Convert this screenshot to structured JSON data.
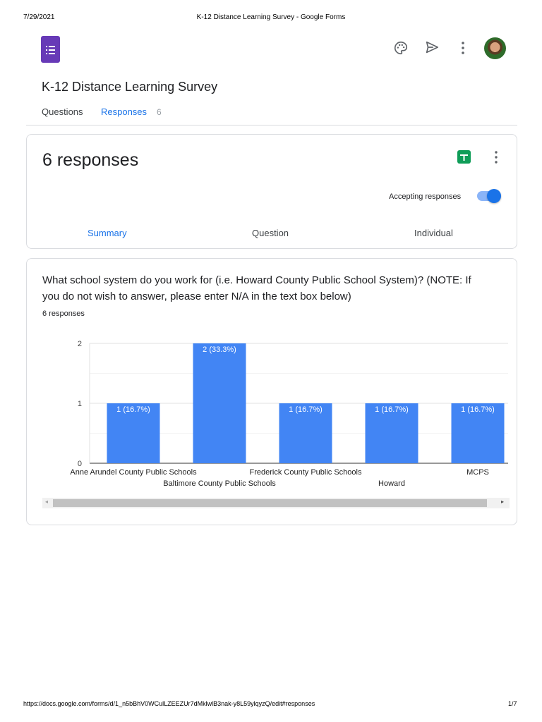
{
  "print_header": {
    "date": "7/29/2021",
    "title": "K-12 Distance Learning Survey - Google Forms"
  },
  "print_footer": {
    "url": "https://docs.google.com/forms/d/1_n5bBhV0WCulLZEEZUr7dMklwlB3nak-y8L59ylqyzQ/edit#responses",
    "page": "1/7"
  },
  "form": {
    "title": "K-12 Distance Learning Survey"
  },
  "tabs": {
    "questions": "Questions",
    "responses": "Responses",
    "responses_count": "6"
  },
  "summary_card": {
    "heading": "6 responses",
    "accepting_label": "Accepting responses",
    "accepting": true,
    "subtabs": [
      "Summary",
      "Question",
      "Individual"
    ]
  },
  "question": {
    "text": "What school system do you work for (i.e. Howard County Public School System)? (NOTE: If you do not wish to answer, please enter N/A in the text box below)",
    "count": "6 responses"
  },
  "colors": {
    "accent": "#1a73e8",
    "bar": "#4285f4",
    "forms_purple": "#673ab7",
    "sheets_green": "#0f9d58"
  },
  "chart_data": {
    "type": "bar",
    "categories": [
      "Anne Arundel County Public Schools",
      "Baltimore County Public Schools",
      "Frederick County Public Schools",
      "Howard",
      "MCPS"
    ],
    "values": [
      1,
      2,
      1,
      1,
      1
    ],
    "data_labels": [
      "1 (16.7%)",
      "2 (33.3%)",
      "1 (16.7%)",
      "1 (16.7%)",
      "1 (16.7%)"
    ],
    "yticks": [
      "0",
      "1",
      "2"
    ],
    "ylim": [
      0,
      2
    ],
    "grid": true
  }
}
